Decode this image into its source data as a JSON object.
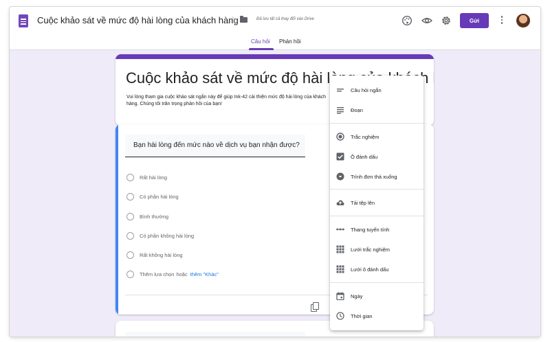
{
  "header": {
    "title": "Cuộc khảo sát về mức độ hài lòng của khách hàng",
    "save_status": "Đã lưu tất cả thay đổi vào Drive",
    "send_label": "Gửi",
    "icons": [
      "palette-icon",
      "preview-eye-icon",
      "settings-gear-icon",
      "more-vert-icon"
    ]
  },
  "tabs": [
    {
      "label": "Câu hỏi",
      "active": true
    },
    {
      "label": "Phản hồi",
      "active": false
    }
  ],
  "form": {
    "title": "Cuộc khảo sát về mức độ hài lòng của khách hàng",
    "description": "Vui lòng tham gia cuộc khảo sát ngắn này để giúp Ink-42 cải thiện mức độ hài lòng của khách hàng. Chúng tôi trân trọng phản hồi của bạn!"
  },
  "question": {
    "text": "Bạn hài lòng đến mức nào về dịch vụ bạn nhận được?",
    "options": [
      "Rất hài lòng",
      "Có phần hài lòng",
      "Bình thường",
      "Có phần không hài lòng",
      "Rất không hài lòng"
    ],
    "add_option": "Thêm lựa chọn",
    "or_label": "hoặc",
    "add_other": "thêm \"Khác\""
  },
  "type_menu": {
    "items": [
      {
        "label": "Câu hỏi ngắn",
        "icon": "short-answer-icon"
      },
      {
        "label": "Đoạn",
        "icon": "paragraph-icon"
      },
      {
        "label": "Trắc nghiệm",
        "icon": "radio-button-icon"
      },
      {
        "label": "Ô đánh dấu",
        "icon": "checkbox-icon"
      },
      {
        "label": "Trình đơn thả xuống",
        "icon": "dropdown-icon"
      },
      {
        "label": "Tải tệp lên",
        "icon": "cloud-upload-icon"
      },
      {
        "label": "Thang tuyến tính",
        "icon": "linear-scale-icon"
      },
      {
        "label": "Lưới trắc nghiệm",
        "icon": "grid-icon"
      },
      {
        "label": "Lưới ô đánh dấu",
        "icon": "grid-icon"
      },
      {
        "label": "Ngày",
        "icon": "calendar-icon"
      },
      {
        "label": "Thời gian",
        "icon": "clock-icon"
      }
    ]
  },
  "colors": {
    "accent": "#673ab7",
    "background": "#f0ebf8",
    "active_question": "#4285f4",
    "link": "#1a73e8"
  }
}
